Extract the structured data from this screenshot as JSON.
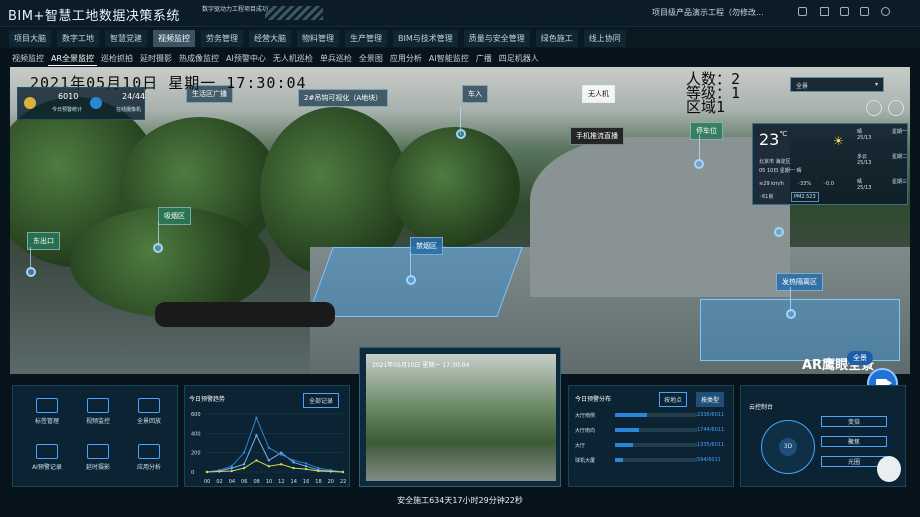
{
  "app": {
    "title": "BIM+智慧工地数据决策系统",
    "notice": "数字驱动力工程项目成功",
    "project": "项目级产品演示工程（勿修改..."
  },
  "main_tabs": [
    "项目大脑",
    "数字工地",
    "智慧党建",
    "视频监控",
    "劳务管理",
    "经营大脑",
    "物料管理",
    "生产管理",
    "BIM与技术管理",
    "质量与安全管理",
    "绿色施工",
    "线上协同"
  ],
  "main_active": 3,
  "sub_tabs": [
    "视频监控",
    "AR全景监控",
    "巡检抓拍",
    "延时摄影",
    "热成像监控",
    "AI预警中心",
    "无人机巡检",
    "单兵巡检",
    "全景图",
    "应用分析",
    "AI智能监控",
    "广播",
    "四足机器人"
  ],
  "sub_active": 1,
  "hud": {
    "datetime": "2021年05月10日  星期一  17:30:04",
    "count_label": "人数：2",
    "level_label": "等级：1",
    "area_label": "区域1",
    "stat1_value": "6010",
    "stat1_label": "今日预警统计",
    "stat2_value": "24/44",
    "stat2_label": "在线摄像机",
    "scope": "全景"
  },
  "scene_labels": {
    "l1": "生活区广播",
    "l2": "2#吊钩可视化（A地块）",
    "l3": "车入",
    "l4": "无人机",
    "l5": "手机推流直播",
    "l6": "停车位",
    "l7": "吸烟区",
    "l8": "东出口",
    "l9": "禁烟区",
    "l10": "发热隔离区"
  },
  "weather": {
    "temp": "23",
    "unit": "℃",
    "city": "北京市 海淀区",
    "date": "05 10日 星期一 晴",
    "wind": "29 km/h",
    "humidity": "33%",
    "rain": "0.0",
    "aqi": "61良",
    "pm": "PM2.523",
    "forecast": [
      {
        "cond": "晴",
        "day": "星期一",
        "temp": "25/13"
      },
      {
        "cond": "多云",
        "day": "星期二",
        "temp": "25/13"
      },
      {
        "cond": "晴",
        "day": "星期三",
        "temp": "25/13"
      }
    ]
  },
  "ar_logo": "AR鹰眼全景",
  "video_pill": "全景",
  "quick": [
    "标签管理",
    "视频监控",
    "全景回放",
    "AI预警记录",
    "延时摄影",
    "应用分析"
  ],
  "trend": {
    "title": "今日预警趋势",
    "btn": "全部记录",
    "yticks": [
      "600",
      "400",
      "200",
      "0"
    ],
    "xticks": [
      "00",
      "02",
      "04",
      "06",
      "08",
      "10",
      "12",
      "14",
      "16",
      "18",
      "20",
      "22"
    ]
  },
  "chart_data": {
    "type": "line",
    "categories": [
      "00",
      "02",
      "04",
      "06",
      "08",
      "10",
      "12",
      "14",
      "16",
      "18",
      "20",
      "22"
    ],
    "series": [
      {
        "values": [
          0,
          10,
          40,
          80,
          380,
          120,
          200,
          100,
          60,
          20,
          10,
          0
        ]
      },
      {
        "values": [
          0,
          20,
          60,
          200,
          560,
          250,
          180,
          120,
          90,
          40,
          20,
          0
        ]
      },
      {
        "values": [
          0,
          5,
          10,
          40,
          120,
          60,
          80,
          40,
          30,
          10,
          5,
          0
        ]
      }
    ],
    "ylim": [
      0,
      600
    ]
  },
  "thumb_time": "2021年05月10日  星期一  17:30:04",
  "warning": {
    "title": "今日预警分布",
    "btn1": "按地点",
    "btn2": "按类型",
    "rows": [
      {
        "name": "大厅南侧",
        "value": "2336/6011",
        "pct": 0.39
      },
      {
        "name": "大厅南向",
        "value": "1744/6011",
        "pct": 0.29
      },
      {
        "name": "大厅",
        "value": "1335/6011",
        "pct": 0.22
      },
      {
        "name": "球机大厦",
        "value": "594/6011",
        "pct": 0.1
      }
    ]
  },
  "ptz": {
    "title": "云控制台",
    "center": "3D",
    "b1": "变倍",
    "b2": "聚焦",
    "b3": "光圈"
  },
  "footer": "安全施工634天17小时29分钟22秒",
  "colors": {
    "accent": "#2b86d6",
    "zone": "#3c96dc"
  }
}
